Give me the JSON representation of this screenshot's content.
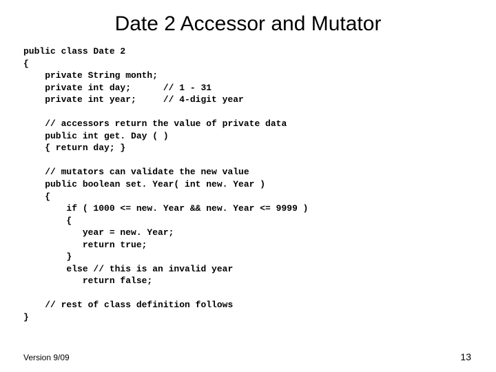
{
  "title": "Date 2 Accessor and Mutator",
  "code": {
    "l01": "public class Date 2",
    "l02": "{",
    "l03": "    private String month;",
    "l04": "    private int day;      // 1 - 31",
    "l05": "    private int year;     // 4-digit year",
    "l06": "",
    "l07": "    // accessors return the value of private data",
    "l08": "    public int get. Day ( )",
    "l09": "    { return day; }",
    "l10": "",
    "l11": "    // mutators can validate the new value",
    "l12": "    public boolean set. Year( int new. Year )",
    "l13": "    {",
    "l14": "        if ( 1000 <= new. Year && new. Year <= 9999 )",
    "l15": "        {",
    "l16": "           year = new. Year;",
    "l17": "           return true;",
    "l18": "        }",
    "l19": "        else // this is an invalid year",
    "l20": "           return false;",
    "l21": "",
    "l22": "    // rest of class definition follows",
    "l23": "}"
  },
  "footer": {
    "version": "Version 9/09",
    "page": "13"
  }
}
